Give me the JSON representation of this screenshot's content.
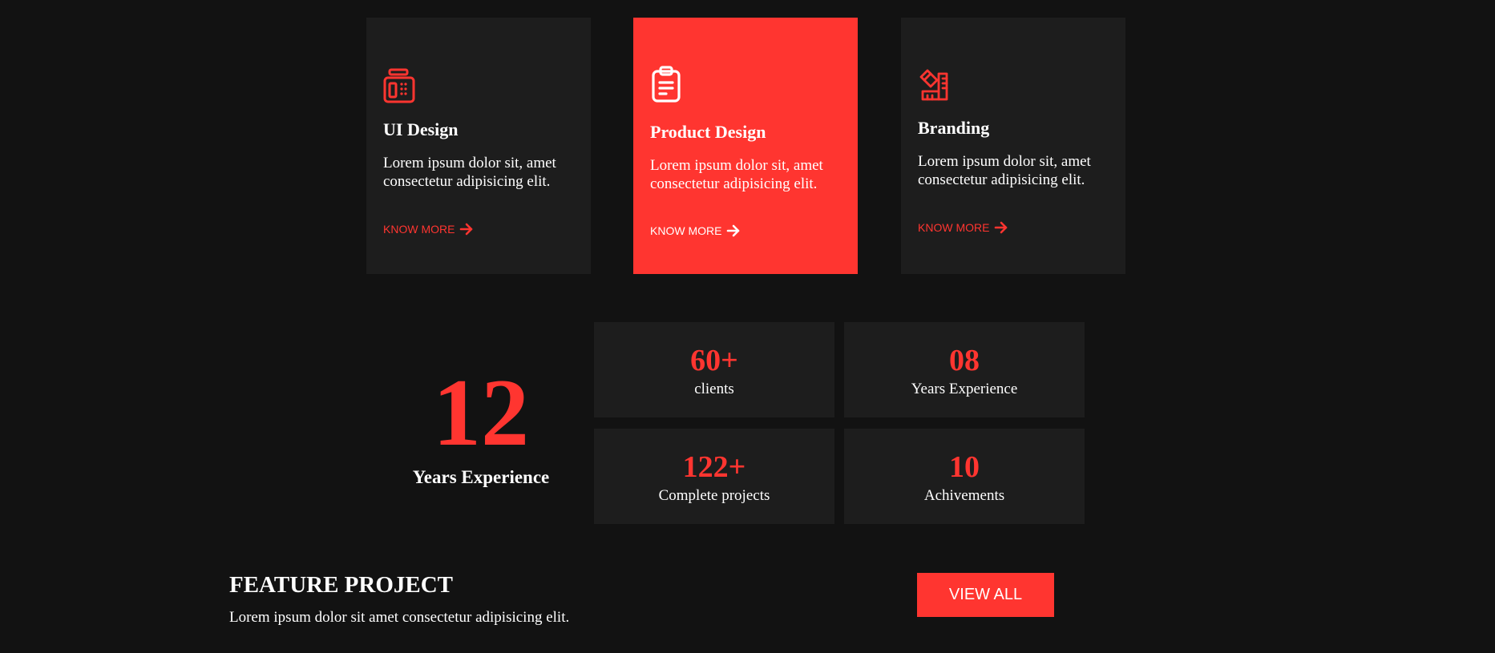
{
  "services": [
    {
      "icon": "fax-machine-icon",
      "title": "UI Design",
      "description": "Lorem ipsum dolor sit, amet consectetur adipisicing elit.",
      "link": "KNOW MORE"
    },
    {
      "icon": "clipboard-icon",
      "title": "Product Design",
      "description": "Lorem ipsum dolor sit, amet consectetur adipisicing elit.",
      "link": "KNOW MORE"
    },
    {
      "icon": "ruler-pencil-icon",
      "title": "Branding",
      "description": "Lorem ipsum dolor sit, amet consectetur adipisicing elit.",
      "link": "KNOW MORE"
    }
  ],
  "experience": {
    "number": "12",
    "label": "Years Experience"
  },
  "stats": [
    {
      "value": "60+",
      "label": "clients"
    },
    {
      "value": "08",
      "label": "Years Experience"
    },
    {
      "value": "122+",
      "label": "Complete projects"
    },
    {
      "value": "10",
      "label": "Achivements"
    }
  ],
  "feature": {
    "title": "FEATURE PROJECT",
    "subtitle": "Lorem ipsum dolor sit amet consectetur adipisicing elit.",
    "button_label": "VIEW ALL"
  },
  "colors": {
    "background": "#121212",
    "card": "#1d1d1d",
    "accent": "#ff3530",
    "text": "#ffffff"
  }
}
